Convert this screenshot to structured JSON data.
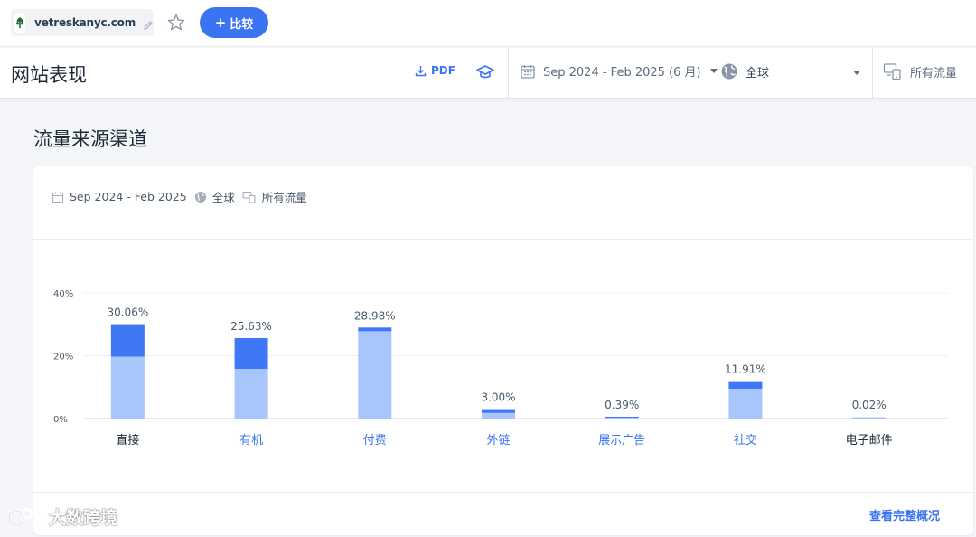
{
  "topbar": {
    "site_name": "vetreskanyc.com",
    "compare_label": "比较",
    "icons": {
      "favicon": "leaf-favicon",
      "edit": "pencil-icon",
      "star": "star-icon",
      "add": "plus-icon"
    }
  },
  "header": {
    "title": "网站表现",
    "pdf_label": "PDF",
    "date_range": "Sep 2024 - Feb 2025 (6 月)",
    "region": "全球",
    "traffic": "所有流量"
  },
  "section": {
    "title": "流量来源渠道",
    "filters": {
      "date": "Sep 2024 - Feb 2025",
      "region": "全球",
      "traffic": "所有流量"
    },
    "view_more": "查看完整概况"
  },
  "colors": {
    "accent": "#3a74f2",
    "bar_dark": "#3e78f5",
    "bar_light": "#a9c6fc",
    "category_link": "#3a74f2",
    "category_plain": "#1d2a3a"
  },
  "chart_data": {
    "type": "bar",
    "stacked": true,
    "categories": [
      "直接",
      "有机",
      "付费",
      "外链",
      "展示广告",
      "社交",
      "电子邮件"
    ],
    "category_is_link": [
      false,
      true,
      true,
      true,
      true,
      true,
      false
    ],
    "totals": [
      30.06,
      25.63,
      28.98,
      3.0,
      0.39,
      11.91,
      0.02
    ],
    "total_labels": [
      "30.06%",
      "25.63%",
      "28.98%",
      "3.00%",
      "0.39%",
      "11.91%",
      "0.02%"
    ],
    "series": [
      {
        "values": [
          19.7,
          15.8,
          27.8,
          1.8,
          0.3,
          9.5,
          0.02
        ]
      },
      {
        "values": [
          10.36,
          9.83,
          1.18,
          1.2,
          0.09,
          2.41,
          0.0
        ]
      }
    ],
    "y_ticks": [
      0,
      20,
      40
    ],
    "y_tick_labels": [
      "0%",
      "20%",
      "40%"
    ],
    "ylim": [
      0,
      40
    ],
    "grid": true
  },
  "watermark": {
    "text": "大数跨境"
  }
}
